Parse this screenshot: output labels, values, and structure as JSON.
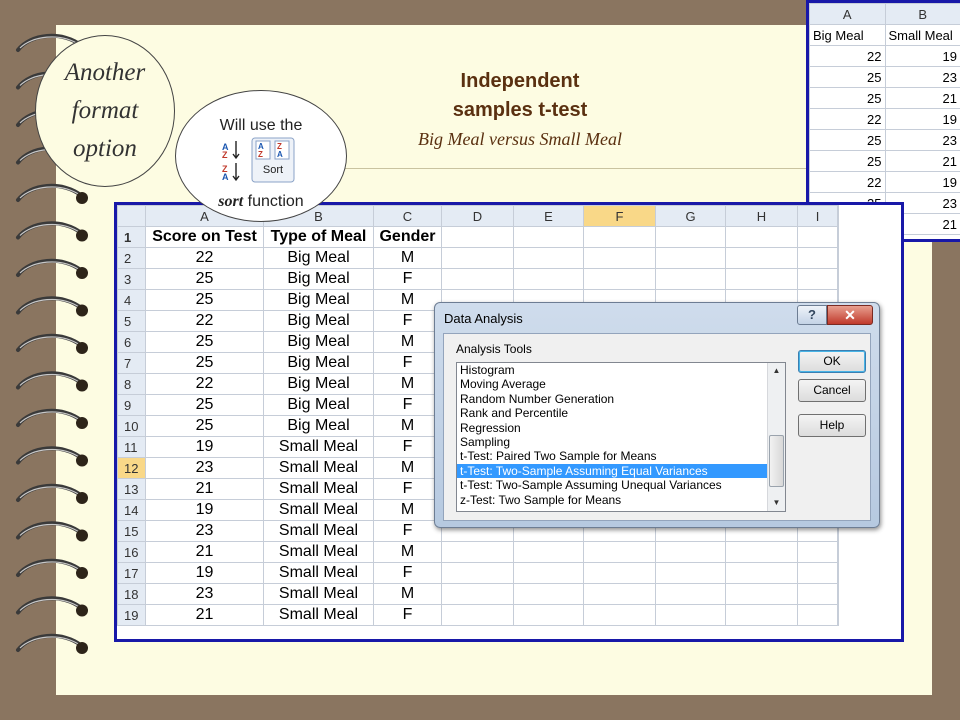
{
  "title_line1": "Independent",
  "title_line2": "samples t-test",
  "subtitle": "Big Meal versus Small Meal",
  "bubble_big": "Another\nformat\noption",
  "bubble_small": {
    "line1": "Will use the",
    "sort_word": "sort",
    "function_word": " function",
    "icon_label": "Sort"
  },
  "sheet": {
    "selected_column": "F",
    "selected_row": "12",
    "columns": [
      "A",
      "B",
      "C",
      "D",
      "E",
      "F",
      "G",
      "H",
      "I"
    ],
    "header_row": {
      "num": "1",
      "cells": [
        "Score on Test",
        "Type of Meal",
        "Gender"
      ]
    },
    "rows": [
      {
        "num": "2",
        "cells": [
          "22",
          "Big Meal",
          "M"
        ]
      },
      {
        "num": "3",
        "cells": [
          "25",
          "Big Meal",
          "F"
        ]
      },
      {
        "num": "4",
        "cells": [
          "25",
          "Big Meal",
          "M"
        ]
      },
      {
        "num": "5",
        "cells": [
          "22",
          "Big Meal",
          "F"
        ]
      },
      {
        "num": "6",
        "cells": [
          "25",
          "Big Meal",
          "M"
        ]
      },
      {
        "num": "7",
        "cells": [
          "25",
          "Big Meal",
          "F"
        ]
      },
      {
        "num": "8",
        "cells": [
          "22",
          "Big Meal",
          "M"
        ]
      },
      {
        "num": "9",
        "cells": [
          "25",
          "Big Meal",
          "F"
        ]
      },
      {
        "num": "10",
        "cells": [
          "25",
          "Big Meal",
          "M"
        ]
      },
      {
        "num": "11",
        "cells": [
          "19",
          "Small Meal",
          "F"
        ]
      },
      {
        "num": "12",
        "cells": [
          "23",
          "Small Meal",
          "M"
        ]
      },
      {
        "num": "13",
        "cells": [
          "21",
          "Small Meal",
          "F"
        ]
      },
      {
        "num": "14",
        "cells": [
          "19",
          "Small Meal",
          "M"
        ]
      },
      {
        "num": "15",
        "cells": [
          "23",
          "Small Meal",
          "F"
        ]
      },
      {
        "num": "16",
        "cells": [
          "21",
          "Small Meal",
          "M"
        ]
      },
      {
        "num": "17",
        "cells": [
          "19",
          "Small Meal",
          "F"
        ]
      },
      {
        "num": "18",
        "cells": [
          "23",
          "Small Meal",
          "M"
        ]
      },
      {
        "num": "19",
        "cells": [
          "21",
          "Small Meal",
          "F"
        ]
      }
    ]
  },
  "inset": {
    "columns": [
      "A",
      "B"
    ],
    "headers": [
      "Big Meal",
      "Small Meal"
    ],
    "rows": [
      [
        "22",
        "19"
      ],
      [
        "25",
        "23"
      ],
      [
        "25",
        "21"
      ],
      [
        "22",
        "19"
      ],
      [
        "25",
        "23"
      ],
      [
        "25",
        "21"
      ],
      [
        "22",
        "19"
      ],
      [
        "25",
        "23"
      ],
      [
        "25",
        "21"
      ]
    ]
  },
  "dialog": {
    "title": "Data Analysis",
    "help_glyph": "?",
    "close_glyph": "✕",
    "tools_label": "Analysis Tools",
    "tools": [
      "Histogram",
      "Moving Average",
      "Random Number Generation",
      "Rank and Percentile",
      "Regression",
      "Sampling",
      "t-Test: Paired Two Sample for Means",
      "t-Test: Two-Sample Assuming Equal Variances",
      "t-Test: Two-Sample Assuming Unequal Variances",
      "z-Test: Two Sample for Means"
    ],
    "selected_tool": "t-Test: Two-Sample Assuming Equal Variances",
    "ok": "OK",
    "cancel": "Cancel",
    "help": "Help"
  },
  "colors": {
    "frame": "#1818a8",
    "accent_title": "#5a3010",
    "selection": "#3399ff",
    "active_header": "#f9d888"
  },
  "icons": [
    "spiral-binding-icon",
    "sort-ascending-icon",
    "sort-descending-icon",
    "sort-dialog-icon",
    "scroll-up-icon",
    "scroll-down-icon"
  ]
}
